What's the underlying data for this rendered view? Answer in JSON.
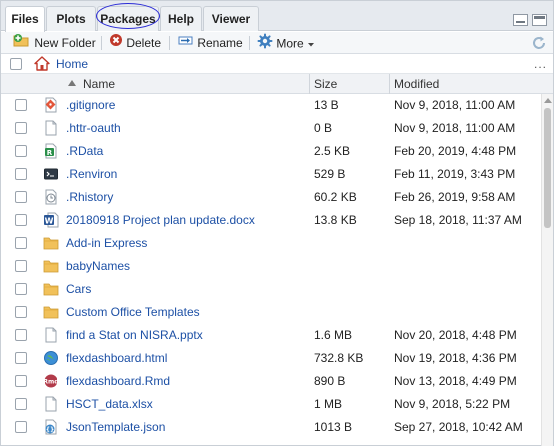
{
  "tabs": [
    {
      "label": "Files",
      "active": true
    },
    {
      "label": "Plots",
      "active": false
    },
    {
      "label": "Packages",
      "active": false
    },
    {
      "label": "Help",
      "active": false
    },
    {
      "label": "Viewer",
      "active": false
    }
  ],
  "toolbar": {
    "new_folder": "New Folder",
    "delete": "Delete",
    "rename": "Rename",
    "more": "More"
  },
  "breadcrumb": {
    "home": "Home",
    "more": "..."
  },
  "columns": {
    "name": "Name",
    "size": "Size",
    "modified": "Modified",
    "sort_column": "name",
    "sort_direction": "ascending"
  },
  "files": [
    {
      "name": ".gitignore",
      "size": "13 B",
      "modified": "Nov 9, 2018, 11:00 AM",
      "icon": "git-file-icon"
    },
    {
      "name": ".httr-oauth",
      "size": "0 B",
      "modified": "Nov 9, 2018, 11:00 AM",
      "icon": "blank-file-icon"
    },
    {
      "name": ".RData",
      "size": "2.5 KB",
      "modified": "Feb 20, 2019, 4:48 PM",
      "icon": "rdata-file-icon"
    },
    {
      "name": ".Renviron",
      "size": "529 B",
      "modified": "Feb 11, 2019, 3:43 PM",
      "icon": "renviron-file-icon"
    },
    {
      "name": ".Rhistory",
      "size": "60.2 KB",
      "modified": "Feb 26, 2019, 9:58 AM",
      "icon": "rhistory-file-icon"
    },
    {
      "name": "20180918 Project plan update.docx",
      "size": "13.8 KB",
      "modified": "Sep 18, 2018, 11:37 AM",
      "icon": "word-file-icon"
    },
    {
      "name": "Add-in Express",
      "size": "",
      "modified": "",
      "icon": "folder-icon"
    },
    {
      "name": "babyNames",
      "size": "",
      "modified": "",
      "icon": "folder-icon"
    },
    {
      "name": "Cars",
      "size": "",
      "modified": "",
      "icon": "folder-icon"
    },
    {
      "name": "Custom Office Templates",
      "size": "",
      "modified": "",
      "icon": "folder-icon"
    },
    {
      "name": "find a Stat on NISRA.pptx",
      "size": "1.6 MB",
      "modified": "Nov 20, 2018, 4:48 PM",
      "icon": "blank-file-icon"
    },
    {
      "name": "flexdashboard.html",
      "size": "732.8 KB",
      "modified": "Nov 19, 2018, 4:36 PM",
      "icon": "html-file-icon"
    },
    {
      "name": "flexdashboard.Rmd",
      "size": "890 B",
      "modified": "Nov 13, 2018, 4:49 PM",
      "icon": "rmd-file-icon"
    },
    {
      "name": "HSCT_data.xlsx",
      "size": "1 MB",
      "modified": "Nov 9, 2018, 5:22 PM",
      "icon": "blank-file-icon"
    },
    {
      "name": "JsonTemplate.json",
      "size": "1013 B",
      "modified": "Sep 27, 2018, 10:42 AM",
      "icon": "json-file-icon"
    }
  ],
  "colors": {
    "link": "#1d50a5",
    "tab_bg": "#e6eaef",
    "annotation_circle": "#2b2bd6",
    "folder": "#f1c15a"
  }
}
